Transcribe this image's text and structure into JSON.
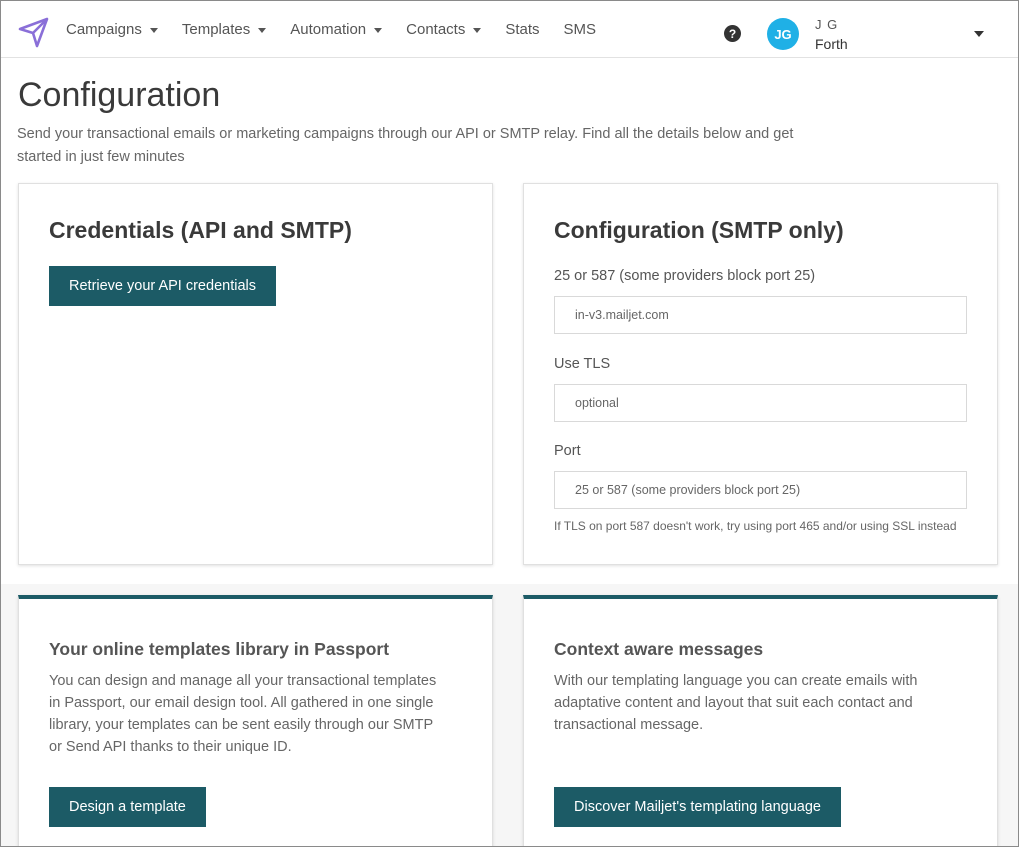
{
  "nav": {
    "items": [
      {
        "label": "Campaigns",
        "has_caret": true
      },
      {
        "label": "Templates",
        "has_caret": true
      },
      {
        "label": "Automation",
        "has_caret": true
      },
      {
        "label": "Contacts",
        "has_caret": true
      },
      {
        "label": "Stats",
        "has_caret": false
      },
      {
        "label": "SMS",
        "has_caret": false
      }
    ],
    "help_glyph": "?"
  },
  "user": {
    "initials": "JG",
    "name": "J G",
    "company": "Forth",
    "avatar_color": "#1fb0e6"
  },
  "page": {
    "title": "Configuration",
    "description": "Send your transactional emails or marketing campaigns through our API or SMTP relay. Find all the details below and get started in just few minutes"
  },
  "credentials": {
    "title": "Credentials (API and SMTP)",
    "button_label": "Retrieve your API credentials"
  },
  "smtp": {
    "title": "Configuration (SMTP only)",
    "fields": [
      {
        "label": "25 or 587 (some providers block port 25)",
        "value": "in-v3.mailjet.com"
      },
      {
        "label": "Use TLS",
        "value": "optional"
      },
      {
        "label": "Port",
        "value": "25 or 587 (some providers block port 25)"
      }
    ],
    "hint": "If TLS on port 587 doesn't work, try using port 465 and/or using SSL instead"
  },
  "features": [
    {
      "title": "Your online templates library in Passport",
      "description": "You can design and manage all your transactional templates in Passport, our email design tool. All gathered in one single library, your templates can be sent easily through our SMTP or Send API thanks to their unique ID.",
      "button_label": "Design a template"
    },
    {
      "title": "Context aware messages",
      "description": "With our templating language you can create emails with adaptative content and layout that suit each contact and transactional message.",
      "button_label": "Discover Mailjet's templating language"
    }
  ],
  "colors": {
    "accent": "#1c5b66",
    "logo": "#8a6fd8"
  }
}
